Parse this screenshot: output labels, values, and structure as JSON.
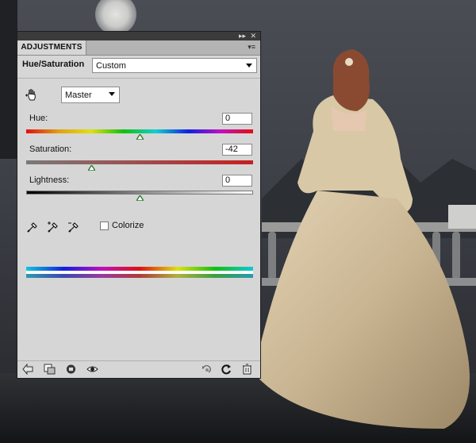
{
  "panel": {
    "tab_label": "ADJUSTMENTS",
    "collapse_icon": "double-chevron-right-icon",
    "close_icon": "close-icon",
    "menu_icon": "panel-menu-icon"
  },
  "adjustment": {
    "title": "Hue/Saturation",
    "preset_value": "Custom",
    "channel_value": "Master"
  },
  "sliders": {
    "hue": {
      "label": "Hue:",
      "value": "0",
      "position": 0.5
    },
    "saturation": {
      "label": "Saturation:",
      "value": "-42",
      "position": 0.29
    },
    "lightness": {
      "label": "Lightness:",
      "value": "0",
      "position": 0.5
    }
  },
  "colorize": {
    "label": "Colorize",
    "checked": false
  },
  "footer_icons": [
    "back-arrow-icon",
    "clip-to-layer-icon",
    "visibility-preview-icon",
    "eye-icon",
    "reset-icon",
    "refresh-icon",
    "trash-icon"
  ],
  "colors": {
    "panel_bg": "#d6d6d6",
    "thumb": "#2f7a2f"
  }
}
